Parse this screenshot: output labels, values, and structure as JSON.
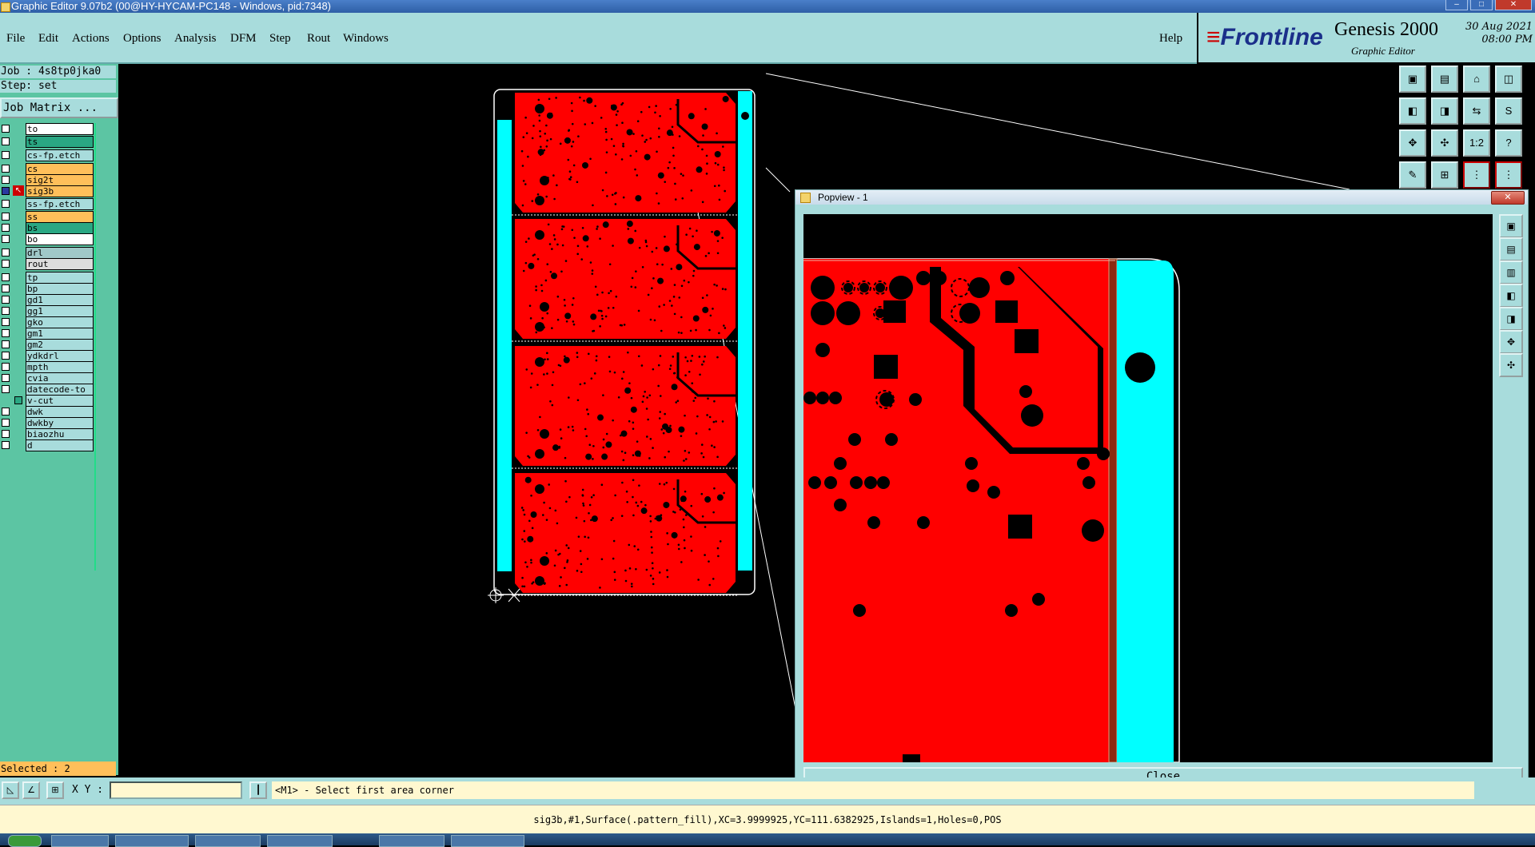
{
  "window": {
    "title": "Graphic Editor 9.07b2 (00@HY-HYCAM-PC148 - Windows, pid:7348)",
    "min": "–",
    "max": "□",
    "close": "✕"
  },
  "menu": {
    "items": [
      "File",
      "Edit",
      "Actions",
      "Options",
      "Analysis",
      "DFM",
      "Step",
      "Rout",
      "Windows"
    ],
    "help": "Help"
  },
  "brand": {
    "logo": "Frontline",
    "product": "Genesis 2000",
    "subtitle": "Graphic Editor",
    "date": "30 Aug 2021",
    "time": "08:00 PM"
  },
  "job": {
    "job_line": "Job : 4s8tp0jka0",
    "step_line": "Step: set",
    "matrix_button": "Job Matrix ..."
  },
  "layers": [
    {
      "name": "to",
      "color": "#ffffff"
    },
    {
      "name": "ts",
      "color": "#2aa783"
    },
    {
      "name": "cs-fp.etch",
      "color": "#a8dcdc"
    },
    {
      "name": "cs",
      "color": "#ffbf5a"
    },
    {
      "name": "sig2t",
      "color": "#ffbf5a"
    },
    {
      "name": "sig3b",
      "color": "#ffbf5a"
    },
    {
      "name": "ss-fp.etch",
      "color": "#a8dcdc"
    },
    {
      "name": "ss",
      "color": "#ffbf5a"
    },
    {
      "name": "bs",
      "color": "#2aa783"
    },
    {
      "name": "bo",
      "color": "#ffffff"
    },
    {
      "name": "drl",
      "color": "#a0c8c8"
    },
    {
      "name": "rout",
      "color": "#dddddd"
    },
    {
      "name": "tp",
      "color": "#a8dcdc"
    },
    {
      "name": "bp",
      "color": "#a8dcdc"
    },
    {
      "name": "gd1",
      "color": "#a8dcdc"
    },
    {
      "name": "gg1",
      "color": "#a8dcdc"
    },
    {
      "name": "gko",
      "color": "#a8dcdc"
    },
    {
      "name": "gm1",
      "color": "#a8dcdc"
    },
    {
      "name": "gm2",
      "color": "#a8dcdc"
    },
    {
      "name": "ydkdrl",
      "color": "#a8dcdc"
    },
    {
      "name": "mpth",
      "color": "#a8dcdc"
    },
    {
      "name": "cvia",
      "color": "#a8dcdc"
    },
    {
      "name": "datecode-to",
      "color": "#a8dcdc"
    },
    {
      "name": "v-cut",
      "color": "#a8dcdc"
    },
    {
      "name": "dwk",
      "color": "#a8dcdc"
    },
    {
      "name": "dwkby",
      "color": "#a8dcdc"
    },
    {
      "name": "biaozhu",
      "color": "#a8dcdc"
    },
    {
      "name": "d",
      "color": "#a8dcdc"
    }
  ],
  "selected": "Selected : 2",
  "popview": {
    "title": "Popview - 1",
    "close_x": "✕",
    "close_button": "Close"
  },
  "right_tools": {
    "ratio_label": "1:2",
    "help_label": "?"
  },
  "command": {
    "xy_label": "X Y :",
    "xy_value": "",
    "prompt": "<M1> - Select first area corner"
  },
  "status": {
    "text": "sig3b,#1,Surface(.pattern_fill),XC=3.9999925,YC=111.6382925,Islands=1,Holes=0,POS"
  },
  "colors": {
    "copper": "#ff0000",
    "panel_frame": "#00ffff",
    "ui_bg": "#a8dcdc",
    "panel_green": "#5cc5a3",
    "active_layer": "#ffbf5a"
  }
}
